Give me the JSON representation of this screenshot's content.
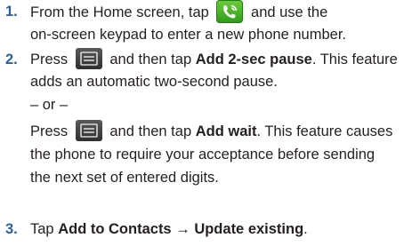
{
  "colors": {
    "step_number": "#2b5fa8",
    "text": "#231f20",
    "phone_icon": "#3cb025",
    "menu_icon": "#3c3c3c"
  },
  "step1": {
    "number": "1.",
    "part1": "From the Home screen, tap",
    "icon": "phone-app-icon",
    "part2": "and use the",
    "line2": "on-screen keypad to enter a new phone number."
  },
  "step2": {
    "number": "2.",
    "a_pre": "Press",
    "a_icon": "menu-key-icon",
    "a_mid": "and then tap",
    "a_bold": "Add 2-sec pause",
    "a_post": ". This feature",
    "a_line2": "adds an automatic two-second pause.",
    "or": "– or –",
    "b_pre": "Press",
    "b_icon": "menu-key-icon",
    "b_mid": "and then tap",
    "b_bold": "Add wait",
    "b_post": ". This feature causes",
    "b_line2": "the phone to require your acceptance before sending",
    "b_line3": "the next set of entered digits."
  },
  "step3": {
    "number": "3.",
    "pre": "Tap",
    "bold1": "Add to Contacts",
    "arrow": "→",
    "bold2": "Update existing",
    "post": "."
  }
}
